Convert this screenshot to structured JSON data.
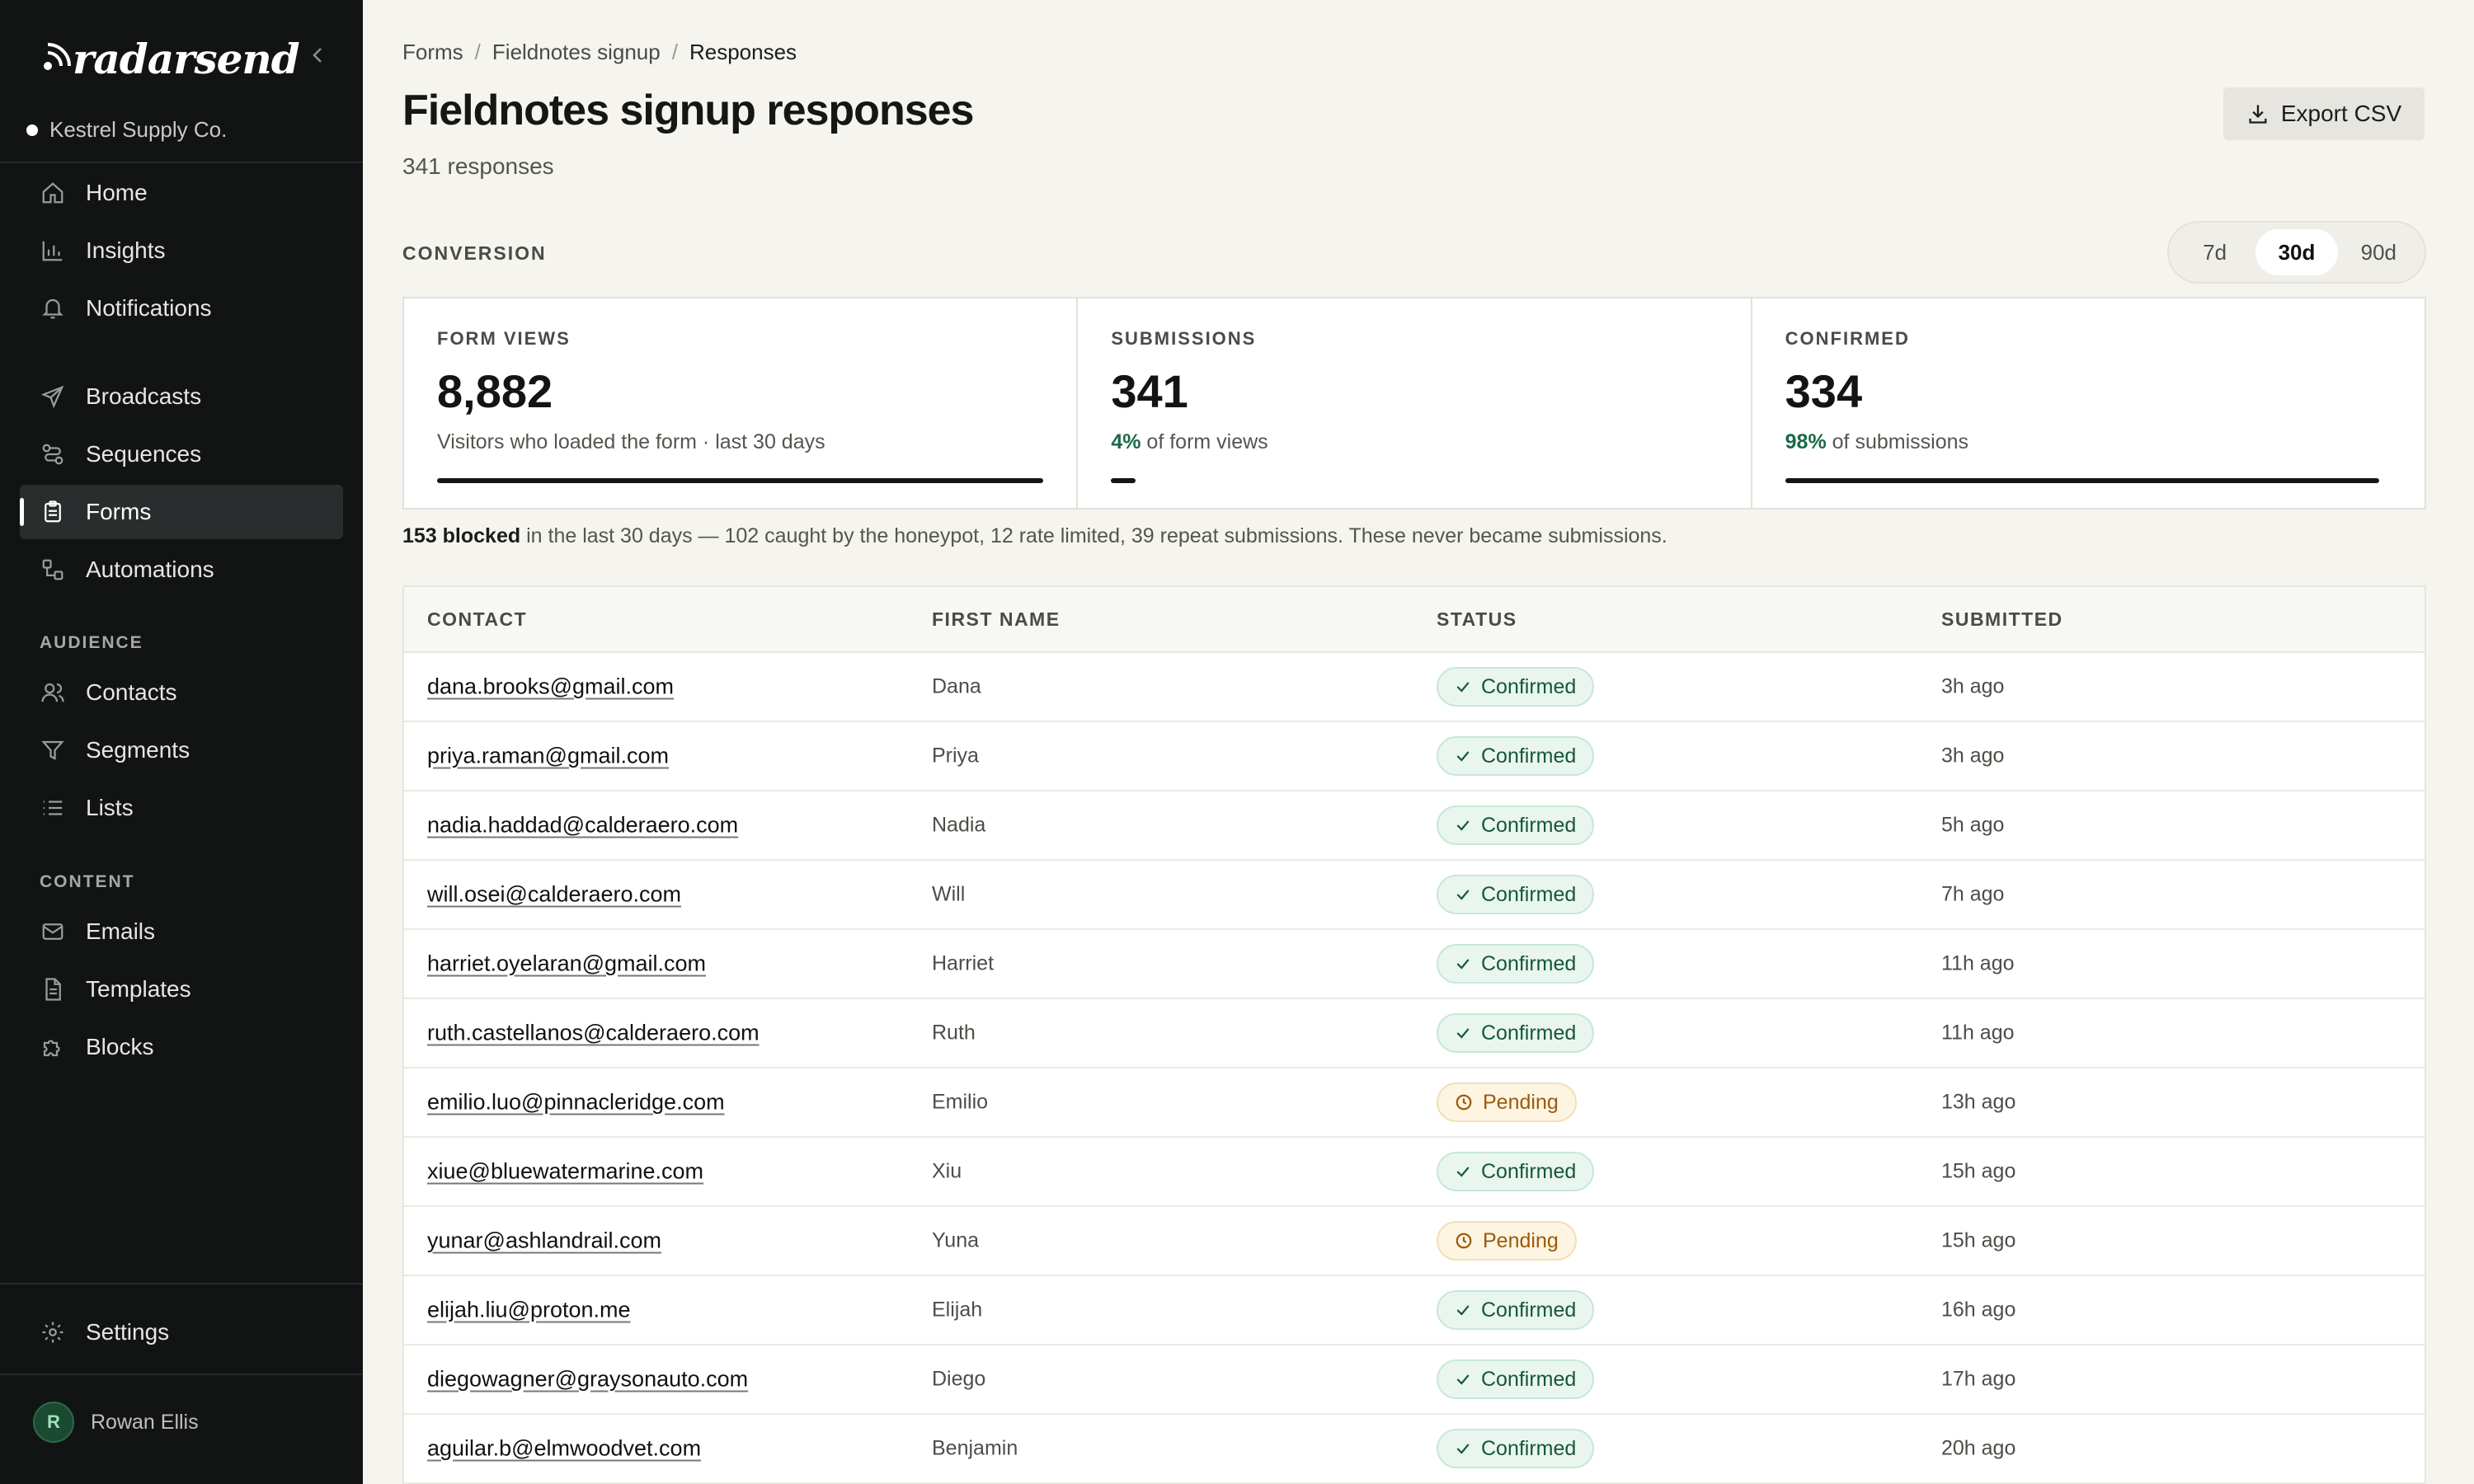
{
  "brand": {
    "name": "radarsend"
  },
  "workspace": {
    "name": "Kestrel Supply Co."
  },
  "nav": {
    "primary": [
      {
        "label": "Home",
        "icon": "home-icon"
      },
      {
        "label": "Insights",
        "icon": "bar-chart-icon"
      },
      {
        "label": "Notifications",
        "icon": "bell-icon"
      }
    ],
    "messaging": [
      {
        "label": "Broadcasts",
        "icon": "send-icon"
      },
      {
        "label": "Sequences",
        "icon": "sequence-icon"
      },
      {
        "label": "Forms",
        "icon": "clipboard-icon",
        "active": true
      },
      {
        "label": "Automations",
        "icon": "automation-icon"
      }
    ],
    "audience_title": "AUDIENCE",
    "audience": [
      {
        "label": "Contacts",
        "icon": "users-icon"
      },
      {
        "label": "Segments",
        "icon": "filter-icon"
      },
      {
        "label": "Lists",
        "icon": "list-icon"
      }
    ],
    "content_title": "CONTENT",
    "content": [
      {
        "label": "Emails",
        "icon": "mail-icon"
      },
      {
        "label": "Templates",
        "icon": "document-icon"
      },
      {
        "label": "Blocks",
        "icon": "puzzle-icon"
      }
    ],
    "settings": {
      "label": "Settings",
      "icon": "gear-icon"
    }
  },
  "user": {
    "name": "Rowan Ellis",
    "initial": "R"
  },
  "breadcrumb": {
    "root": "Forms",
    "form": "Fieldnotes signup",
    "current": "Responses",
    "separator": "/"
  },
  "header": {
    "title": "Fieldnotes signup responses",
    "subtitle": "341 responses",
    "export_label": "Export CSV"
  },
  "conversion": {
    "label": "CONVERSION",
    "ranges": [
      "7d",
      "30d",
      "90d"
    ],
    "selected_range": "30d",
    "stats": [
      {
        "label": "FORM VIEWS",
        "value": "8,882",
        "pct": "",
        "desc": "Visitors who loaded the form · last 30 days",
        "fill": 1.0
      },
      {
        "label": "SUBMISSIONS",
        "value": "341",
        "pct": "4%",
        "desc": "of form views",
        "fill": 0.04
      },
      {
        "label": "CONFIRMED",
        "value": "334",
        "pct": "98%",
        "desc": "of submissions",
        "fill": 0.98
      }
    ]
  },
  "blocked_note": {
    "count": "153 blocked",
    "text": "in the last 30 days — 102 caught by the honeypot, 12 rate limited, 39 repeat submissions. These never became submissions."
  },
  "table": {
    "columns": [
      "CONTACT",
      "FIRST NAME",
      "STATUS",
      "SUBMITTED"
    ],
    "rows": [
      {
        "email": "dana.brooks@gmail.com",
        "first": "Dana",
        "status": "Confirmed",
        "time": "3h ago"
      },
      {
        "email": "priya.raman@gmail.com",
        "first": "Priya",
        "status": "Confirmed",
        "time": "3h ago"
      },
      {
        "email": "nadia.haddad@calderaero.com",
        "first": "Nadia",
        "status": "Confirmed",
        "time": "5h ago"
      },
      {
        "email": "will.osei@calderaero.com",
        "first": "Will",
        "status": "Confirmed",
        "time": "7h ago"
      },
      {
        "email": "harriet.oyelaran@gmail.com",
        "first": "Harriet",
        "status": "Confirmed",
        "time": "11h ago"
      },
      {
        "email": "ruth.castellanos@calderaero.com",
        "first": "Ruth",
        "status": "Confirmed",
        "time": "11h ago"
      },
      {
        "email": "emilio.luo@pinnacleridge.com",
        "first": "Emilio",
        "status": "Pending",
        "time": "13h ago"
      },
      {
        "email": "xiue@bluewatermarine.com",
        "first": "Xiu",
        "status": "Confirmed",
        "time": "15h ago"
      },
      {
        "email": "yunar@ashlandrail.com",
        "first": "Yuna",
        "status": "Pending",
        "time": "15h ago"
      },
      {
        "email": "elijah.liu@proton.me",
        "first": "Elijah",
        "status": "Confirmed",
        "time": "16h ago"
      },
      {
        "email": "diegowagner@graysonauto.com",
        "first": "Diego",
        "status": "Confirmed",
        "time": "17h ago"
      },
      {
        "email": "aguilar.b@elmwoodvet.com",
        "first": "Benjamin",
        "status": "Confirmed",
        "time": "20h ago"
      }
    ]
  },
  "colors": {
    "sidebar_bg": "#121414",
    "page_bg": "#f5f4ef",
    "confirmed": "#17563a",
    "pending": "#9a5b0c",
    "accent_pct": "#1a6a4a"
  }
}
